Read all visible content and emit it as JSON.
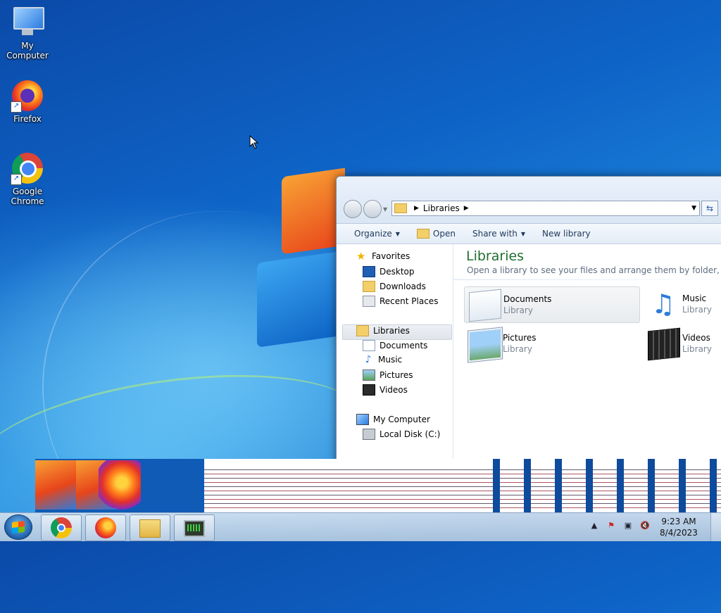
{
  "desktop": {
    "icons": [
      {
        "label": "My Computer",
        "icon": "computer-icon"
      },
      {
        "label": "Firefox",
        "icon": "firefox-icon"
      },
      {
        "label": "Google Chrome",
        "icon": "chrome-icon"
      }
    ]
  },
  "explorer": {
    "address": {
      "crumb": "Libraries"
    },
    "toolbar": {
      "organize": "Organize",
      "open": "Open",
      "share_with": "Share with",
      "new_library": "New library"
    },
    "nav": {
      "favorites": "Favorites",
      "desktop": "Desktop",
      "downloads": "Downloads",
      "recent_places": "Recent Places",
      "libraries": "Libraries",
      "documents": "Documents",
      "music": "Music",
      "pictures": "Pictures",
      "videos": "Videos",
      "my_computer": "My Computer",
      "local_disk": "Local Disk (C:)"
    },
    "content": {
      "heading": "Libraries",
      "subtitle": "Open a library to see your files and arrange them by folder, date, and",
      "libraries": [
        {
          "name": "Documents",
          "type": "Library"
        },
        {
          "name": "Music",
          "type": "Library"
        },
        {
          "name": "Pictures",
          "type": "Library"
        },
        {
          "name": "Videos",
          "type": "Library"
        }
      ]
    }
  },
  "taskbar": {
    "clock": {
      "time": "9:23 AM",
      "date": "8/4/2023"
    },
    "pinned": [
      "chrome-icon",
      "firefox-icon",
      "explorer-icon",
      "task-manager-icon"
    ]
  },
  "colors": {
    "heading_green": "#1e6f2e",
    "desktop_blue": "#0e63c6"
  }
}
